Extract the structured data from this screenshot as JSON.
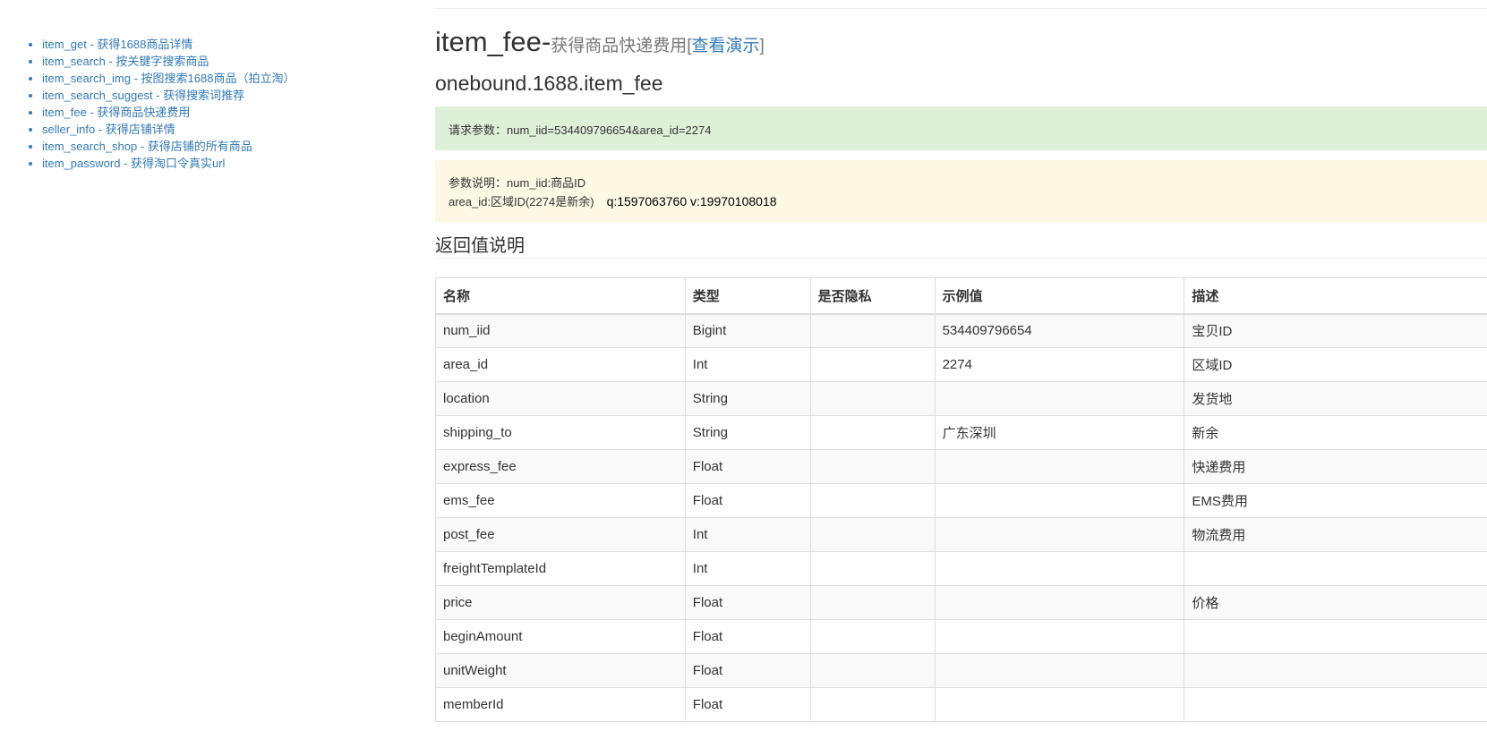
{
  "sidebar": {
    "items": [
      {
        "label": "item_get - 获得1688商品详情"
      },
      {
        "label": "item_search - 按关键字搜索商品"
      },
      {
        "label": "item_search_img - 按图搜索1688商品（拍立淘）"
      },
      {
        "label": "item_search_suggest - 获得搜索词推荐"
      },
      {
        "label": "item_fee - 获得商品快递费用"
      },
      {
        "label": "seller_info - 获得店铺详情"
      },
      {
        "label": "item_search_shop - 获得店铺的所有商品"
      },
      {
        "label": "item_password - 获得淘口令真实url"
      }
    ]
  },
  "header": {
    "title": "item_fee-",
    "subtitle": "获得商品快递费用",
    "bracket_open": "[",
    "demo_link": "查看演示",
    "bracket_close": "]",
    "api_name": "onebound.1688.item_fee"
  },
  "request": {
    "text": "请求参数：num_iid=534409796654&area_id=2274"
  },
  "params": {
    "line1": "参数说明：num_iid:商品ID",
    "line2": "area_id:区域ID(2274是新余)",
    "contact": "q:1597063760 v:19970108018"
  },
  "returns": {
    "title": "返回值说明",
    "columns": [
      "名称",
      "类型",
      "是否隐私",
      "示例值",
      "描述"
    ],
    "rows": [
      [
        "num_iid",
        "Bigint",
        "",
        "534409796654",
        "宝贝ID"
      ],
      [
        "area_id",
        "Int",
        "",
        "2274",
        "区域ID"
      ],
      [
        "location",
        "String",
        "",
        "",
        "发货地"
      ],
      [
        "shipping_to",
        "String",
        "",
        "广东深圳",
        "新余"
      ],
      [
        "express_fee",
        "Float",
        "",
        "",
        "快递费用"
      ],
      [
        "ems_fee",
        "Float",
        "",
        "",
        "EMS费用"
      ],
      [
        "post_fee",
        "Int",
        "",
        "",
        "物流费用"
      ],
      [
        "freightTemplateId",
        "Int",
        "",
        "",
        ""
      ],
      [
        "price",
        "Float",
        "",
        "",
        "价格"
      ],
      [
        "beginAmount",
        "Float",
        "",
        "",
        ""
      ],
      [
        "unitWeight",
        "Float",
        "",
        "",
        ""
      ],
      [
        "memberId",
        "Float",
        "",
        "",
        ""
      ]
    ]
  }
}
